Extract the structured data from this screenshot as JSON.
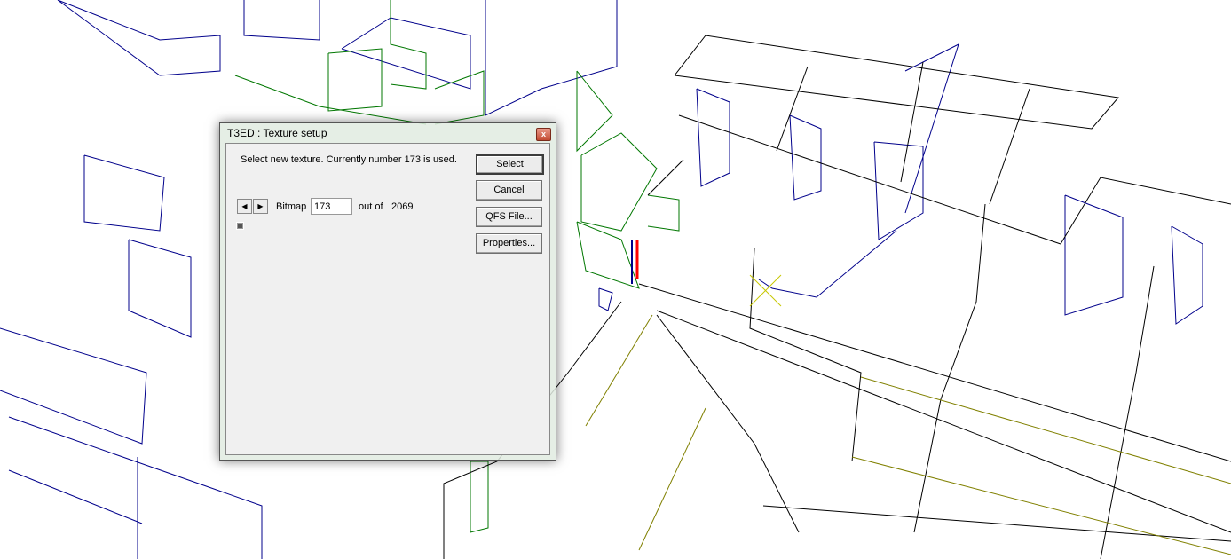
{
  "dialog": {
    "title": "T3ED : Texture setup",
    "close_label": "x",
    "message": "Select new texture. Currently number 173 is used.",
    "buttons": {
      "select": "Select",
      "cancel": "Cancel",
      "qfs": "QFS File...",
      "properties": "Properties..."
    },
    "prev_label": "◀",
    "next_label": "▶",
    "bitmap_label": "Bitmap",
    "bitmap_value": "173",
    "out_of_label": "out of",
    "total": "2069"
  },
  "colors": {
    "wire_black": "#000000",
    "wire_blue": "#00008b",
    "wire_green": "#007700",
    "wire_olive": "#808000",
    "selected_red": "#ff0000"
  }
}
